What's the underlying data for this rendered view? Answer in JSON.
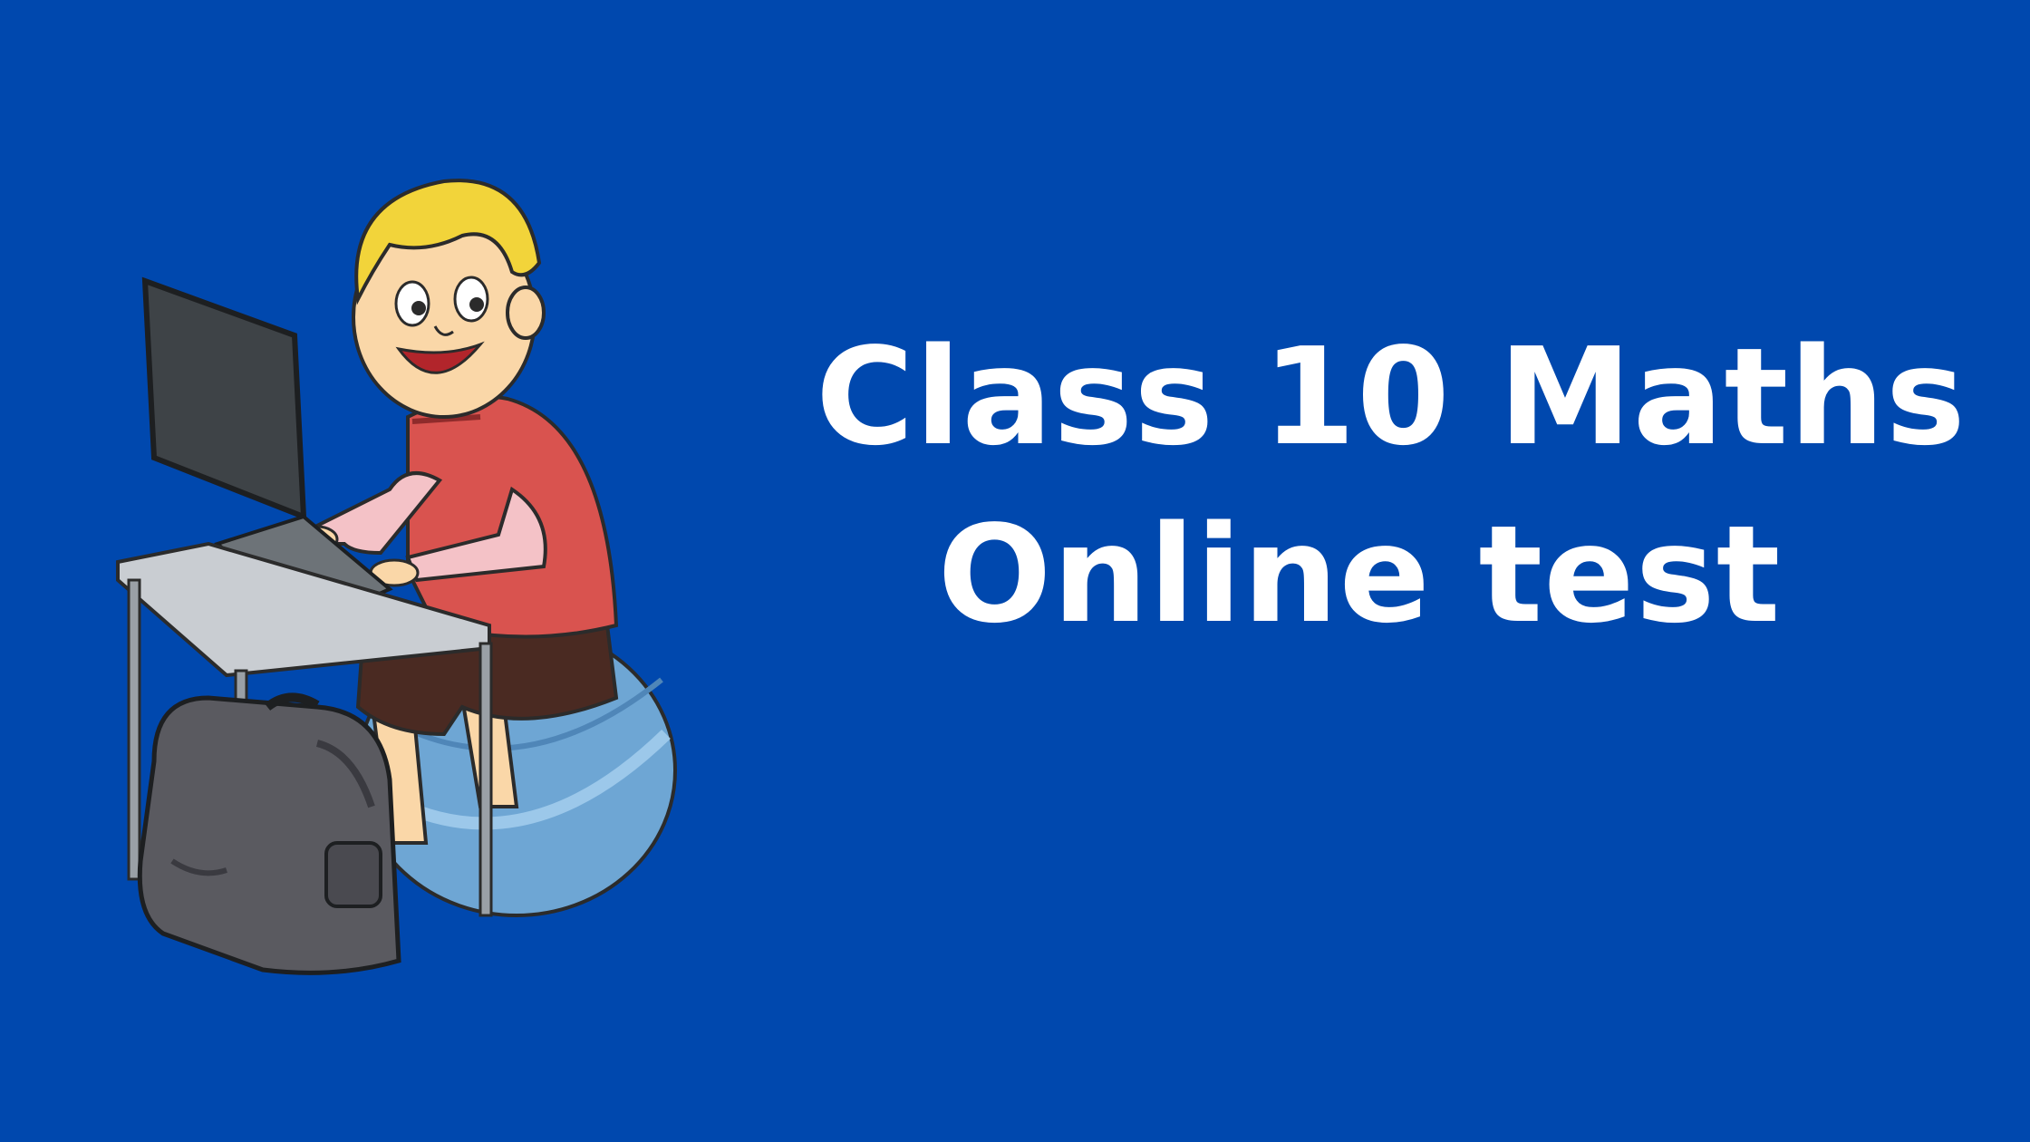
{
  "colors": {
    "background": "#0048AE",
    "title_text": "#FFFFFF",
    "hair": "#F2D43A",
    "shirt": "#D9534F",
    "sleeve": "#F4C2C7",
    "skin": "#FAD7A8",
    "shorts": "#4A2A22",
    "ball": "#6EA6D4",
    "laptop": "#3E4347",
    "desk": "#C9CDD2",
    "backpack": "#5A5A60"
  },
  "illustration": {
    "subject": "boy typing on laptop while sitting on exercise ball",
    "icon": "student-laptop-icon"
  },
  "title": {
    "line1": "Class 10 Maths",
    "line2": "Online test"
  }
}
